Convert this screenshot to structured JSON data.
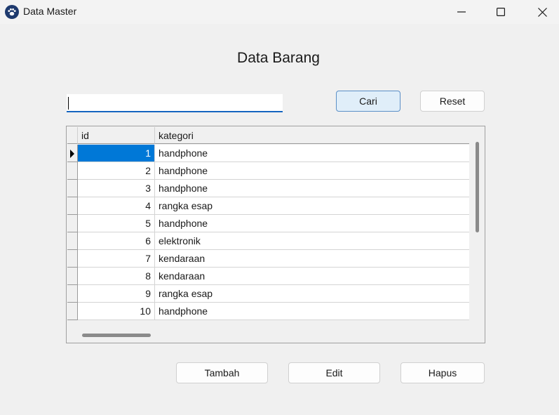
{
  "window": {
    "title": "Data Master",
    "icon": "paw-icon",
    "controls": [
      "minimize-icon",
      "maximize-icon",
      "close-icon"
    ]
  },
  "heading": "Data Barang",
  "search": {
    "value": "",
    "placeholder": ""
  },
  "buttons": {
    "cari": "Cari",
    "reset": "Reset",
    "tambah": "Tambah",
    "edit": "Edit",
    "hapus": "Hapus"
  },
  "grid": {
    "columns": [
      "id",
      "kategori"
    ],
    "selected_row_index": 0,
    "rows": [
      {
        "id": "1",
        "kategori": "handphone"
      },
      {
        "id": "2",
        "kategori": "handphone"
      },
      {
        "id": "3",
        "kategori": "handphone"
      },
      {
        "id": "4",
        "kategori": "rangka esap"
      },
      {
        "id": "5",
        "kategori": "handphone"
      },
      {
        "id": "6",
        "kategori": "elektronik"
      },
      {
        "id": "7",
        "kategori": "kendaraan"
      },
      {
        "id": "8",
        "kategori": "kendaraan"
      },
      {
        "id": "9",
        "kategori": "rangka esap"
      },
      {
        "id": "10",
        "kategori": "handphone"
      }
    ]
  },
  "colors": {
    "selection": "#0078d7",
    "accent_border": "#1565c0",
    "cari_button_bg": "#e0eef9"
  }
}
